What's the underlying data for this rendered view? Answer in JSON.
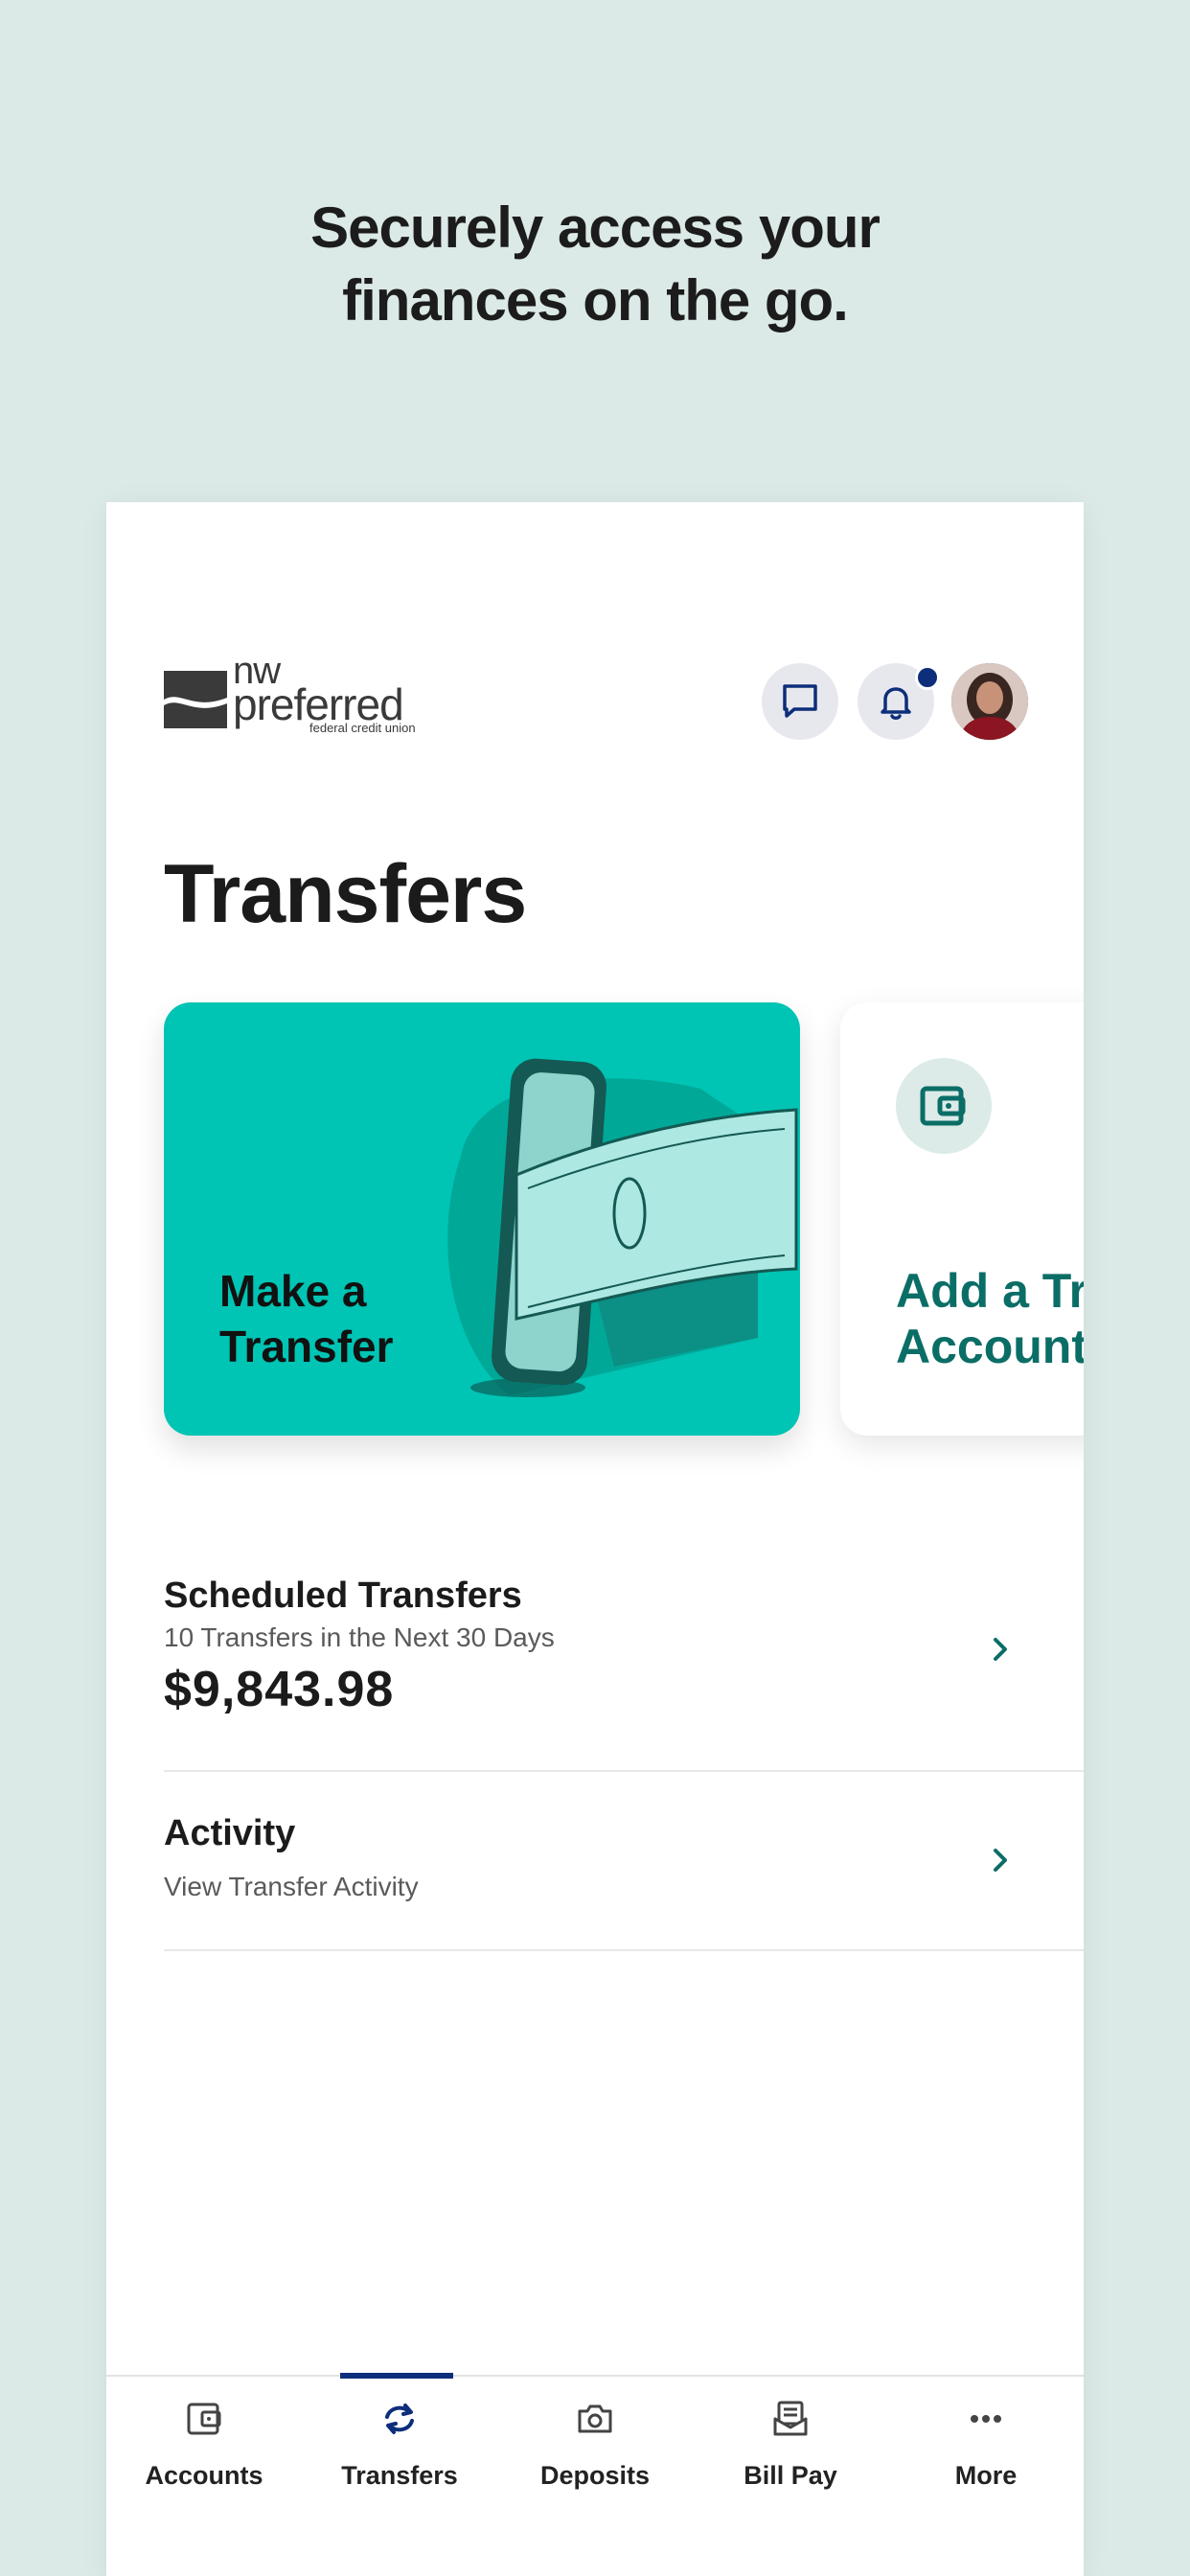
{
  "promo": {
    "headline_line1": "Securely access your",
    "headline_line2": "finances on the go."
  },
  "header": {
    "logo_nw": "nw",
    "logo_preferred": "preferred",
    "logo_sub": "federal credit union",
    "icons": [
      "chat-icon",
      "bell-icon",
      "avatar"
    ],
    "has_notification": true
  },
  "page": {
    "title": "Transfers"
  },
  "cards": {
    "make_transfer": {
      "line1": "Make a",
      "line2": "Transfer"
    },
    "add_account": {
      "line1": "Add a Transfer",
      "line2": "Account"
    }
  },
  "list": {
    "scheduled": {
      "title": "Scheduled Transfers",
      "subtitle": "10 Transfers in the Next 30 Days",
      "amount": "$9,843.98"
    },
    "activity": {
      "title": "Activity",
      "subtitle": "View Transfer Activity"
    }
  },
  "tabbar": {
    "active": "Transfers",
    "tabs": [
      {
        "label": "Accounts",
        "icon": "wallet-icon"
      },
      {
        "label": "Transfers",
        "icon": "transfer-arrows-icon"
      },
      {
        "label": "Deposits",
        "icon": "camera-icon"
      },
      {
        "label": "Bill Pay",
        "icon": "bill-icon"
      },
      {
        "label": "More",
        "icon": "more-dots-icon"
      }
    ]
  },
  "colors": {
    "background": "#dbe9e7",
    "accent_teal": "#00c4b4",
    "dark_teal": "#0b6e66",
    "navy": "#0d2e7a"
  }
}
